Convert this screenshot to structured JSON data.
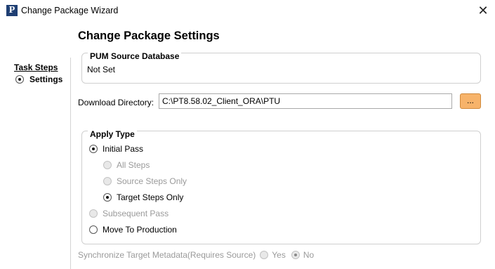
{
  "window": {
    "title": "Change Package Wizard",
    "app_icon_letter": "P",
    "close_glyph": "✕"
  },
  "sidebar": {
    "title": "Task Steps",
    "steps": [
      {
        "label": "Settings",
        "selected": true
      }
    ]
  },
  "main": {
    "page_title": "Change Package Settings",
    "pum_source": {
      "legend": "PUM Source Database",
      "value": "Not Set"
    },
    "download": {
      "label": "Download Directory:",
      "value": "C:\\PT8.58.02_Client_ORA\\PTU",
      "browse_label": "..."
    },
    "apply_type": {
      "legend": "Apply Type",
      "options": {
        "initial_pass": {
          "label": "Initial Pass",
          "checked": true,
          "enabled": true
        },
        "all_steps": {
          "label": "All Steps",
          "checked": false,
          "enabled": false
        },
        "source_steps_only": {
          "label": "Source Steps Only",
          "checked": false,
          "enabled": false
        },
        "target_steps_only": {
          "label": "Target Steps Only",
          "checked": true,
          "enabled": true
        },
        "subsequent_pass": {
          "label": "Subsequent Pass",
          "checked": false,
          "enabled": false
        },
        "move_to_production": {
          "label": "Move To Production",
          "checked": false,
          "enabled": true
        }
      }
    },
    "sync_target_metadata": {
      "label": "Synchronize Target Metadata(Requires Source)",
      "yes_label": "Yes",
      "no_label": "No",
      "selected": "No",
      "enabled": false
    }
  },
  "colors": {
    "browse_button": "#f7b36a",
    "app_icon": "#1f3f73",
    "disabled_text": "#9a9a9a"
  }
}
